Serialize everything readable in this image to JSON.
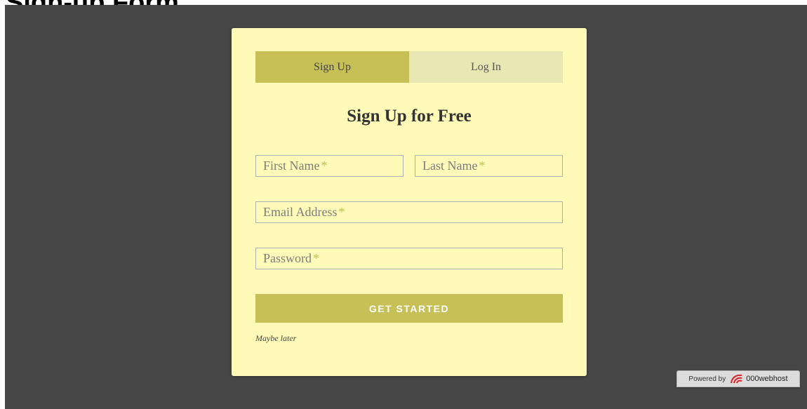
{
  "page": {
    "heading": "Sign-up Form"
  },
  "tabs": [
    {
      "label": "Sign Up",
      "active": true
    },
    {
      "label": "Log In",
      "active": false
    }
  ],
  "form": {
    "title": "Sign Up for Free",
    "first_name": {
      "placeholder": "First Name",
      "required_mark": "*"
    },
    "last_name": {
      "placeholder": "Last Name",
      "required_mark": "*"
    },
    "email": {
      "placeholder": "Email Address",
      "required_mark": "*"
    },
    "password": {
      "placeholder": "Password",
      "required_mark": "*"
    },
    "submit_label": "GET STARTED",
    "maybe_later": "Maybe later"
  },
  "footer_badge": {
    "powered_by": "Powered by",
    "brand": "000webhost",
    "icon": "000webhost-logo-icon"
  },
  "colors": {
    "overlay": "#474747",
    "card": "#fffab8",
    "accent": "#c6c056",
    "tab_inactive": "#e8e7b4"
  }
}
